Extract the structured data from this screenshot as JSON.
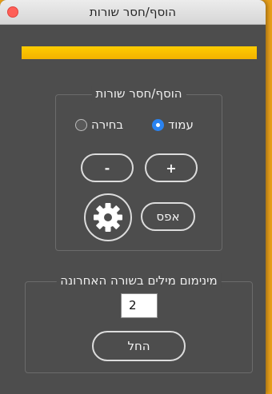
{
  "window": {
    "title": "הוסף/חסר שורות"
  },
  "progress": {
    "value": 1.0
  },
  "lines_group": {
    "label": "הוסף/חסר שורות",
    "mode_options": [
      {
        "label": "עמוד",
        "selected": true
      },
      {
        "label": "בחירה",
        "selected": false
      }
    ],
    "minus_label": "-",
    "plus_label": "+",
    "reset_label": "אפס"
  },
  "min_words_group": {
    "label": "מינימום מילים בשורה האחרונה",
    "value": "2",
    "start_label": "החל"
  },
  "icons": {
    "close": "close-icon",
    "settings": "gear-icon"
  },
  "colors": {
    "accent": "#2a83f1",
    "progress": "#ffcc00",
    "window_bg": "#4d4d4d",
    "desktop": "#e9a01a"
  }
}
